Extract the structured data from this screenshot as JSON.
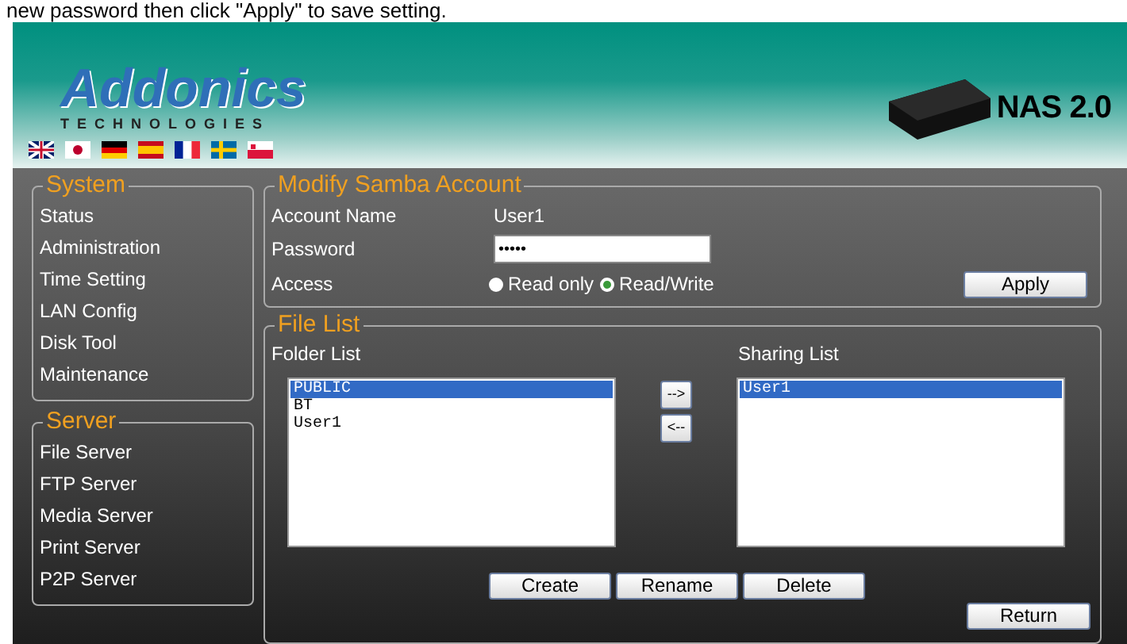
{
  "instruction": "new password then click \"Apply\" to save setting.",
  "header": {
    "logo": "Addonics",
    "logo_tagline": "TECHNOLOGIES",
    "product": "NAS 2.0"
  },
  "sidebar": [
    {
      "title": "System",
      "items": [
        "Status",
        "Administration",
        "Time Setting",
        "LAN Config",
        "Disk Tool",
        "Maintenance"
      ]
    },
    {
      "title": "Server",
      "items": [
        "File Server",
        "FTP Server",
        "Media Server",
        "Print Server",
        "P2P Server"
      ]
    }
  ],
  "account": {
    "title": "Modify Samba Account",
    "name_label": "Account Name",
    "name_value": "User1",
    "password_label": "Password",
    "password_value": "•••••",
    "access_label": "Access",
    "access_options": [
      {
        "label": "Read only",
        "selected": false
      },
      {
        "label": "Read/Write",
        "selected": true
      }
    ],
    "apply": "Apply"
  },
  "file_list": {
    "title": "File List",
    "folder_label": "Folder List",
    "sharing_label": "Sharing List",
    "folders": [
      {
        "label": "PUBLIC",
        "selected": true
      },
      {
        "label": "BT",
        "selected": false
      },
      {
        "label": "User1",
        "selected": false
      }
    ],
    "sharing": [
      {
        "label": "User1",
        "selected": true
      }
    ],
    "move_buttons": [
      "-->",
      "<--"
    ],
    "buttons": [
      "Create",
      "Rename",
      "Delete"
    ],
    "return": "Return"
  }
}
